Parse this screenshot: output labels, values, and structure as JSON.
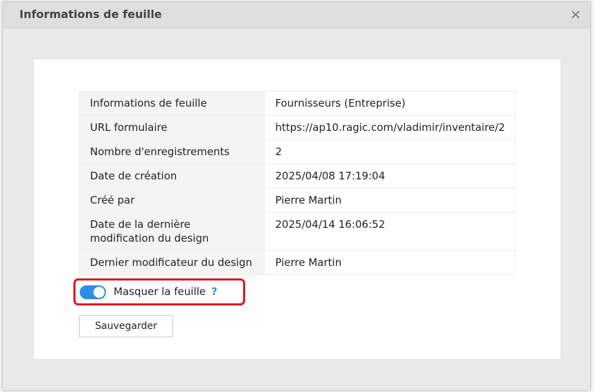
{
  "dialog": {
    "title": "Informations de feuille",
    "close_icon": "close-icon"
  },
  "info_table": {
    "rows": [
      {
        "label": "Informations de feuille",
        "value": "Fournisseurs (Entreprise)"
      },
      {
        "label": "URL formulaire",
        "value": "https://ap10.ragic.com/vladimir/inventaire/2"
      },
      {
        "label": "Nombre d'enregistrements",
        "value": "2"
      },
      {
        "label": "Date de création",
        "value": "2025/04/08 17:19:04"
      },
      {
        "label": "Créé par",
        "value": "Pierre Martin"
      },
      {
        "label": "Date de la dernière modification du design",
        "value": "2025/04/14 16:06:52"
      },
      {
        "label": "Dernier modificateur du design",
        "value": "Pierre Martin"
      }
    ]
  },
  "hide_sheet": {
    "label": "Masquer la feuille",
    "enabled": true,
    "help": "?"
  },
  "actions": {
    "save_label": "Sauvegarder"
  },
  "colors": {
    "accent": "#2f8de4",
    "highlight": "#e0141e"
  }
}
